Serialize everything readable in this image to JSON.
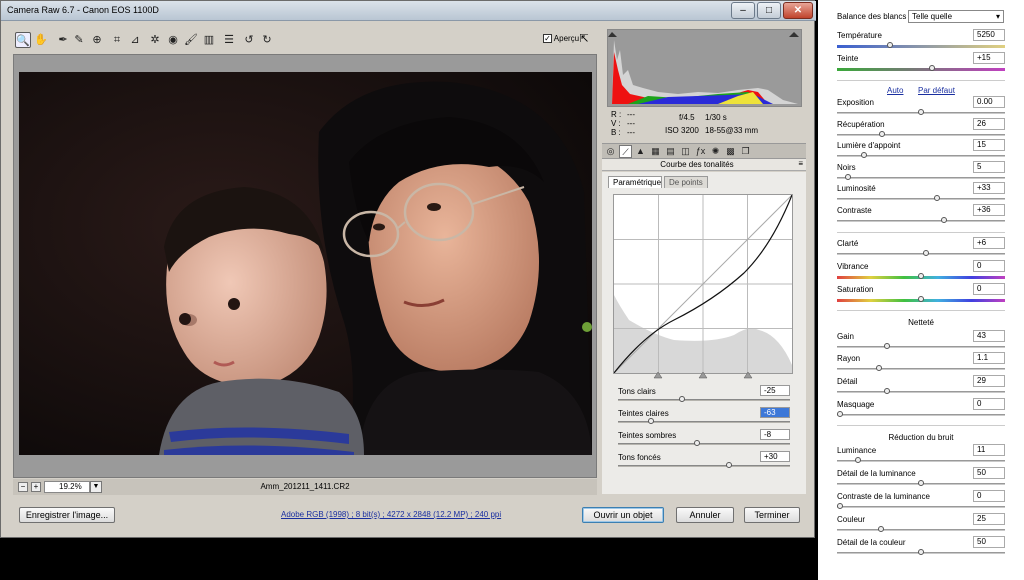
{
  "window": {
    "title": "Camera Raw 6.7  -  Canon EOS 1100D"
  },
  "toolbar": {
    "preview_label": "Aperçu"
  },
  "status": {
    "zoom": "19.2%",
    "filename": "Amm_201211_1411.CR2"
  },
  "bottom": {
    "save_label": "Enregistrer l'image...",
    "workflow_link": "Adobe RGB (1998) ; 8 bit(s) ; 4272 x 2848 (12.2 MP) ; 240 ppi",
    "open_label": "Ouvrir un objet",
    "cancel_label": "Annuler",
    "done_label": "Terminer"
  },
  "info": {
    "r": "R :",
    "v": "V :",
    "b": "B :",
    "dash": "---",
    "aperture": "f/4.5",
    "shutter": "1/30 s",
    "iso": "ISO 3200",
    "lens": "18-55@33 mm"
  },
  "panel": {
    "title": "Courbe des tonalités",
    "tab_param": "Paramétrique",
    "tab_points": "De points",
    "sliders": [
      {
        "label": "Tons clairs",
        "value": "-25",
        "pos": 0.37
      },
      {
        "label": "Teintes claires",
        "value": "-63",
        "pos": 0.18
      },
      {
        "label": "Teintes sombres",
        "value": "-8",
        "pos": 0.46
      },
      {
        "label": "Tons foncés",
        "value": "+30",
        "pos": 0.65
      }
    ]
  },
  "right": {
    "wb_label": "Balance des blancs :",
    "wb_value": "Telle quelle",
    "auto": "Auto",
    "default": "Par défaut",
    "sharpening": "Netteté",
    "noise": "Réduction du bruit",
    "rows": [
      {
        "label": "Température",
        "value": "5250",
        "pos": 0.31
      },
      {
        "label": "Teinte",
        "value": "+15",
        "pos": 0.57
      },
      {
        "label": "Exposition",
        "value": "0.00",
        "pos": 0.5
      },
      {
        "label": "Récupération",
        "value": "26",
        "pos": 0.26
      },
      {
        "label": "Lumière d'appoint",
        "value": "15",
        "pos": 0.15
      },
      {
        "label": "Noirs",
        "value": "5",
        "pos": 0.05
      },
      {
        "label": "Luminosité",
        "value": "+33",
        "pos": 0.6
      },
      {
        "label": "Contraste",
        "value": "+36",
        "pos": 0.64
      },
      {
        "label": "Clarté",
        "value": "+6",
        "pos": 0.53
      },
      {
        "label": "Vibrance",
        "value": "0",
        "pos": 0.5
      },
      {
        "label": "Saturation",
        "value": "0",
        "pos": 0.5
      },
      {
        "label": "Gain",
        "value": "43",
        "pos": 0.29
      },
      {
        "label": "Rayon",
        "value": "1.1",
        "pos": 0.24
      },
      {
        "label": "Détail",
        "value": "29",
        "pos": 0.29
      },
      {
        "label": "Masquage",
        "value": "0",
        "pos": 0.0
      },
      {
        "label": "Luminance",
        "value": "11",
        "pos": 0.11
      },
      {
        "label": "Détail de la luminance",
        "value": "50",
        "pos": 0.5
      },
      {
        "label": "Contraste de la luminance",
        "value": "0",
        "pos": 0.0
      },
      {
        "label": "Couleur",
        "value": "25",
        "pos": 0.25
      },
      {
        "label": "Détail de la couleur",
        "value": "50",
        "pos": 0.5
      }
    ]
  }
}
